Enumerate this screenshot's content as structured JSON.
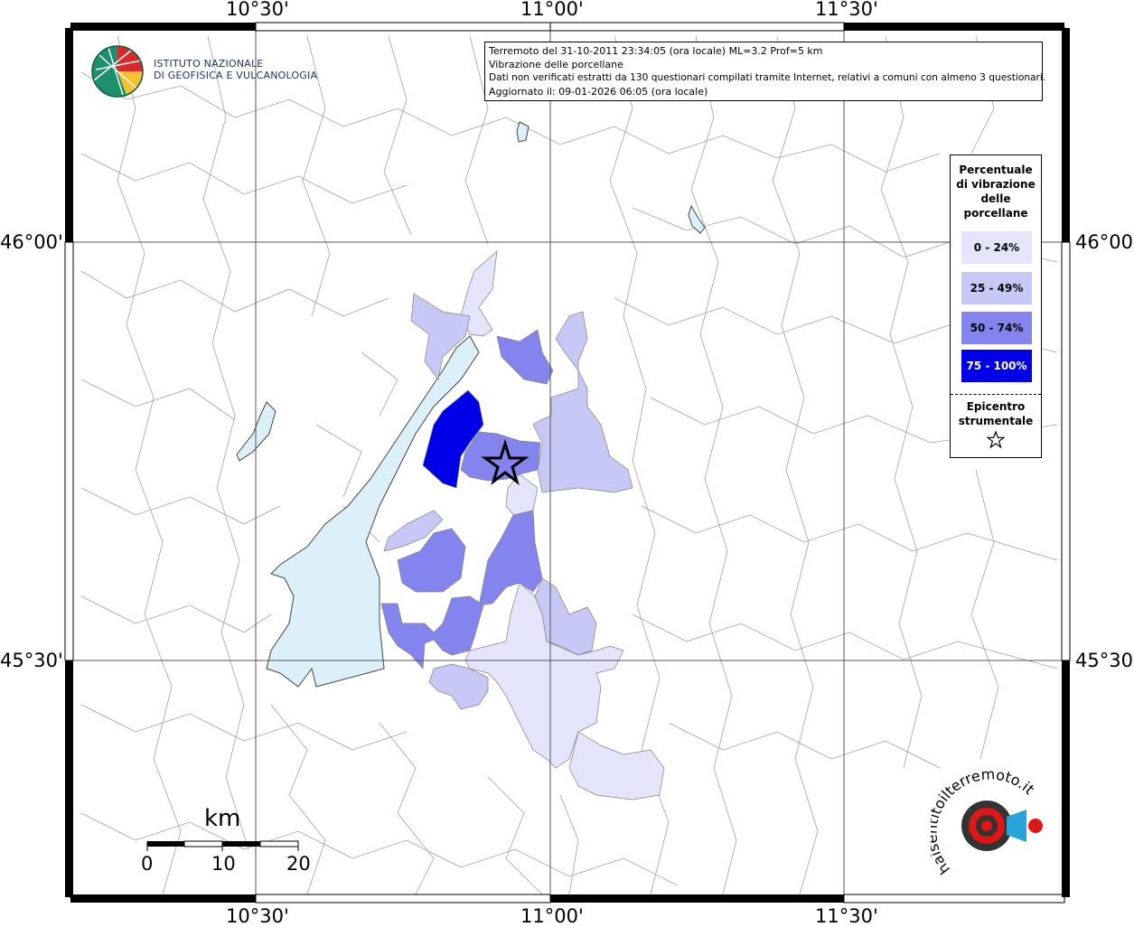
{
  "info": {
    "line1": "Terremoto del 31-10-2011 23:34:05 (ora locale) ML=3.2 Prof=5 km",
    "line2": "Vibrazione delle porcellane",
    "line3": "Dati non verificati estratti da 130 questionari compilati tramite Internet, relativi a comuni con almeno 3 questionari.",
    "line4": "Aggiornato il: 09-01-2026 06:05 (ora locale)"
  },
  "axes": {
    "lon_top": [
      "10°30'",
      "11°00'",
      "11°30'"
    ],
    "lon_bottom": [
      "10°30'",
      "11°00'",
      "11°30'"
    ],
    "lat_left": [
      "46°00'",
      "45°30'"
    ],
    "lat_right": [
      "46°00'",
      "45°30'"
    ]
  },
  "logo": {
    "line1": "Istituto Nazionale",
    "line2": "di Geofisica e Vulcanologia"
  },
  "legend": {
    "title_line1": "Percentuale",
    "title_line2": "di vibrazione",
    "title_line3": "delle",
    "title_line4": "porcellane",
    "classes": [
      {
        "label": "0 - 24%",
        "color": "#e4e4fa"
      },
      {
        "label": "25 - 49%",
        "color": "#c8c8f6"
      },
      {
        "label": "50 - 74%",
        "color": "#8484ee"
      },
      {
        "label": "75 - 100%",
        "color": "#0000e8"
      }
    ],
    "epi_line1": "Epicentro",
    "epi_line2": "strumentale"
  },
  "scale": {
    "unit": "km",
    "ticks": [
      "0",
      "10",
      "20"
    ]
  },
  "epicenter": {
    "lat": "45.80",
    "lon": "10.90"
  },
  "badge": {
    "text": "haisentitoilterremoto.it"
  },
  "colors": {
    "lake": "#dcf0fa",
    "border_line": "#999999"
  }
}
